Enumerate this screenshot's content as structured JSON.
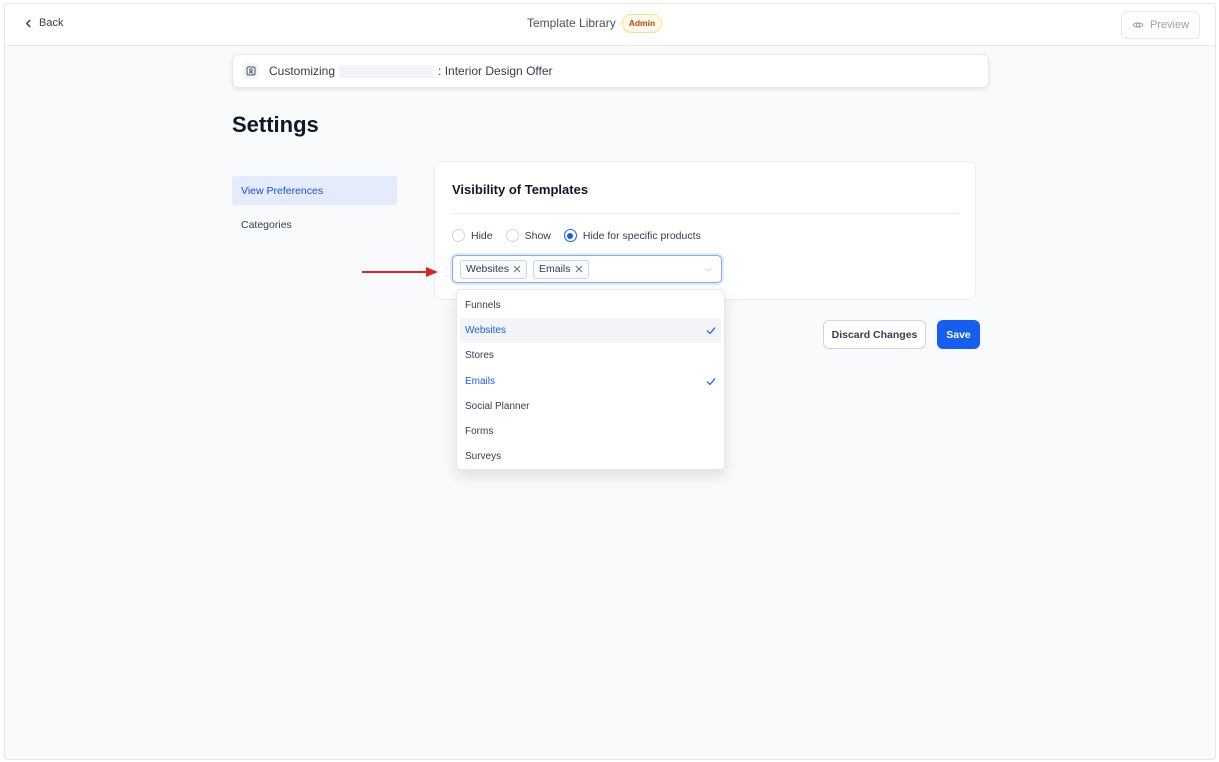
{
  "topbar": {
    "back_label": "Back",
    "title": "Template Library",
    "badge": "Admin",
    "preview_label": "Preview"
  },
  "customizing": {
    "prefix": "Customizing",
    "suffix": ": Interior Design Offer"
  },
  "page_title": "Settings",
  "sidebar": {
    "items": [
      {
        "label": "View Preferences",
        "active": true
      },
      {
        "label": "Categories",
        "active": false
      }
    ]
  },
  "visibility": {
    "title": "Visibility of Templates",
    "options": [
      "Hide",
      "Show",
      "Hide for specific products"
    ],
    "selected_option": "Hide for specific products",
    "selected_tags": [
      "Websites",
      "Emails"
    ]
  },
  "dropdown": {
    "options": [
      {
        "label": "Funnels",
        "selected": false
      },
      {
        "label": "Websites",
        "selected": true
      },
      {
        "label": "Stores",
        "selected": false
      },
      {
        "label": "Emails",
        "selected": true
      },
      {
        "label": "Social Planner",
        "selected": false
      },
      {
        "label": "Forms",
        "selected": false
      },
      {
        "label": "Surveys",
        "selected": false
      }
    ],
    "highlighted": "Websites"
  },
  "actions": {
    "discard_label": "Discard Changes",
    "save_label": "Save"
  },
  "colors": {
    "accent": "#155eef",
    "arrow": "#e02424",
    "badge_text": "#b54708",
    "active_nav_bg": "#e4ebfb"
  }
}
